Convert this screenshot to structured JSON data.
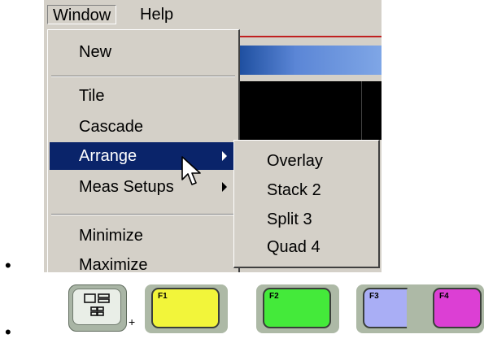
{
  "menubar": {
    "items": [
      "Window",
      "Help"
    ]
  },
  "window_menu": {
    "items": [
      {
        "label": "New"
      },
      {
        "label": "Tile"
      },
      {
        "label": "Cascade"
      },
      {
        "label": "Arrange",
        "has_submenu": true,
        "highlighted": true
      },
      {
        "label": "Meas Setups",
        "has_submenu": true
      },
      {
        "label": "Minimize"
      },
      {
        "label": "Maximize"
      }
    ]
  },
  "arrange_submenu": {
    "items": [
      "Overlay",
      "Stack 2",
      "Split  3",
      "Quad  4"
    ]
  },
  "keys": {
    "window_key_icon": "window-layout-icon",
    "plus": "+",
    "function_keys": [
      {
        "label": "F1",
        "color": "#f2f53a"
      },
      {
        "label": "F2",
        "color": "#44ea3a"
      },
      {
        "label": "F3",
        "color": "#a9aef5"
      },
      {
        "label": "F4",
        "color": "#dc3fd4"
      }
    ]
  }
}
